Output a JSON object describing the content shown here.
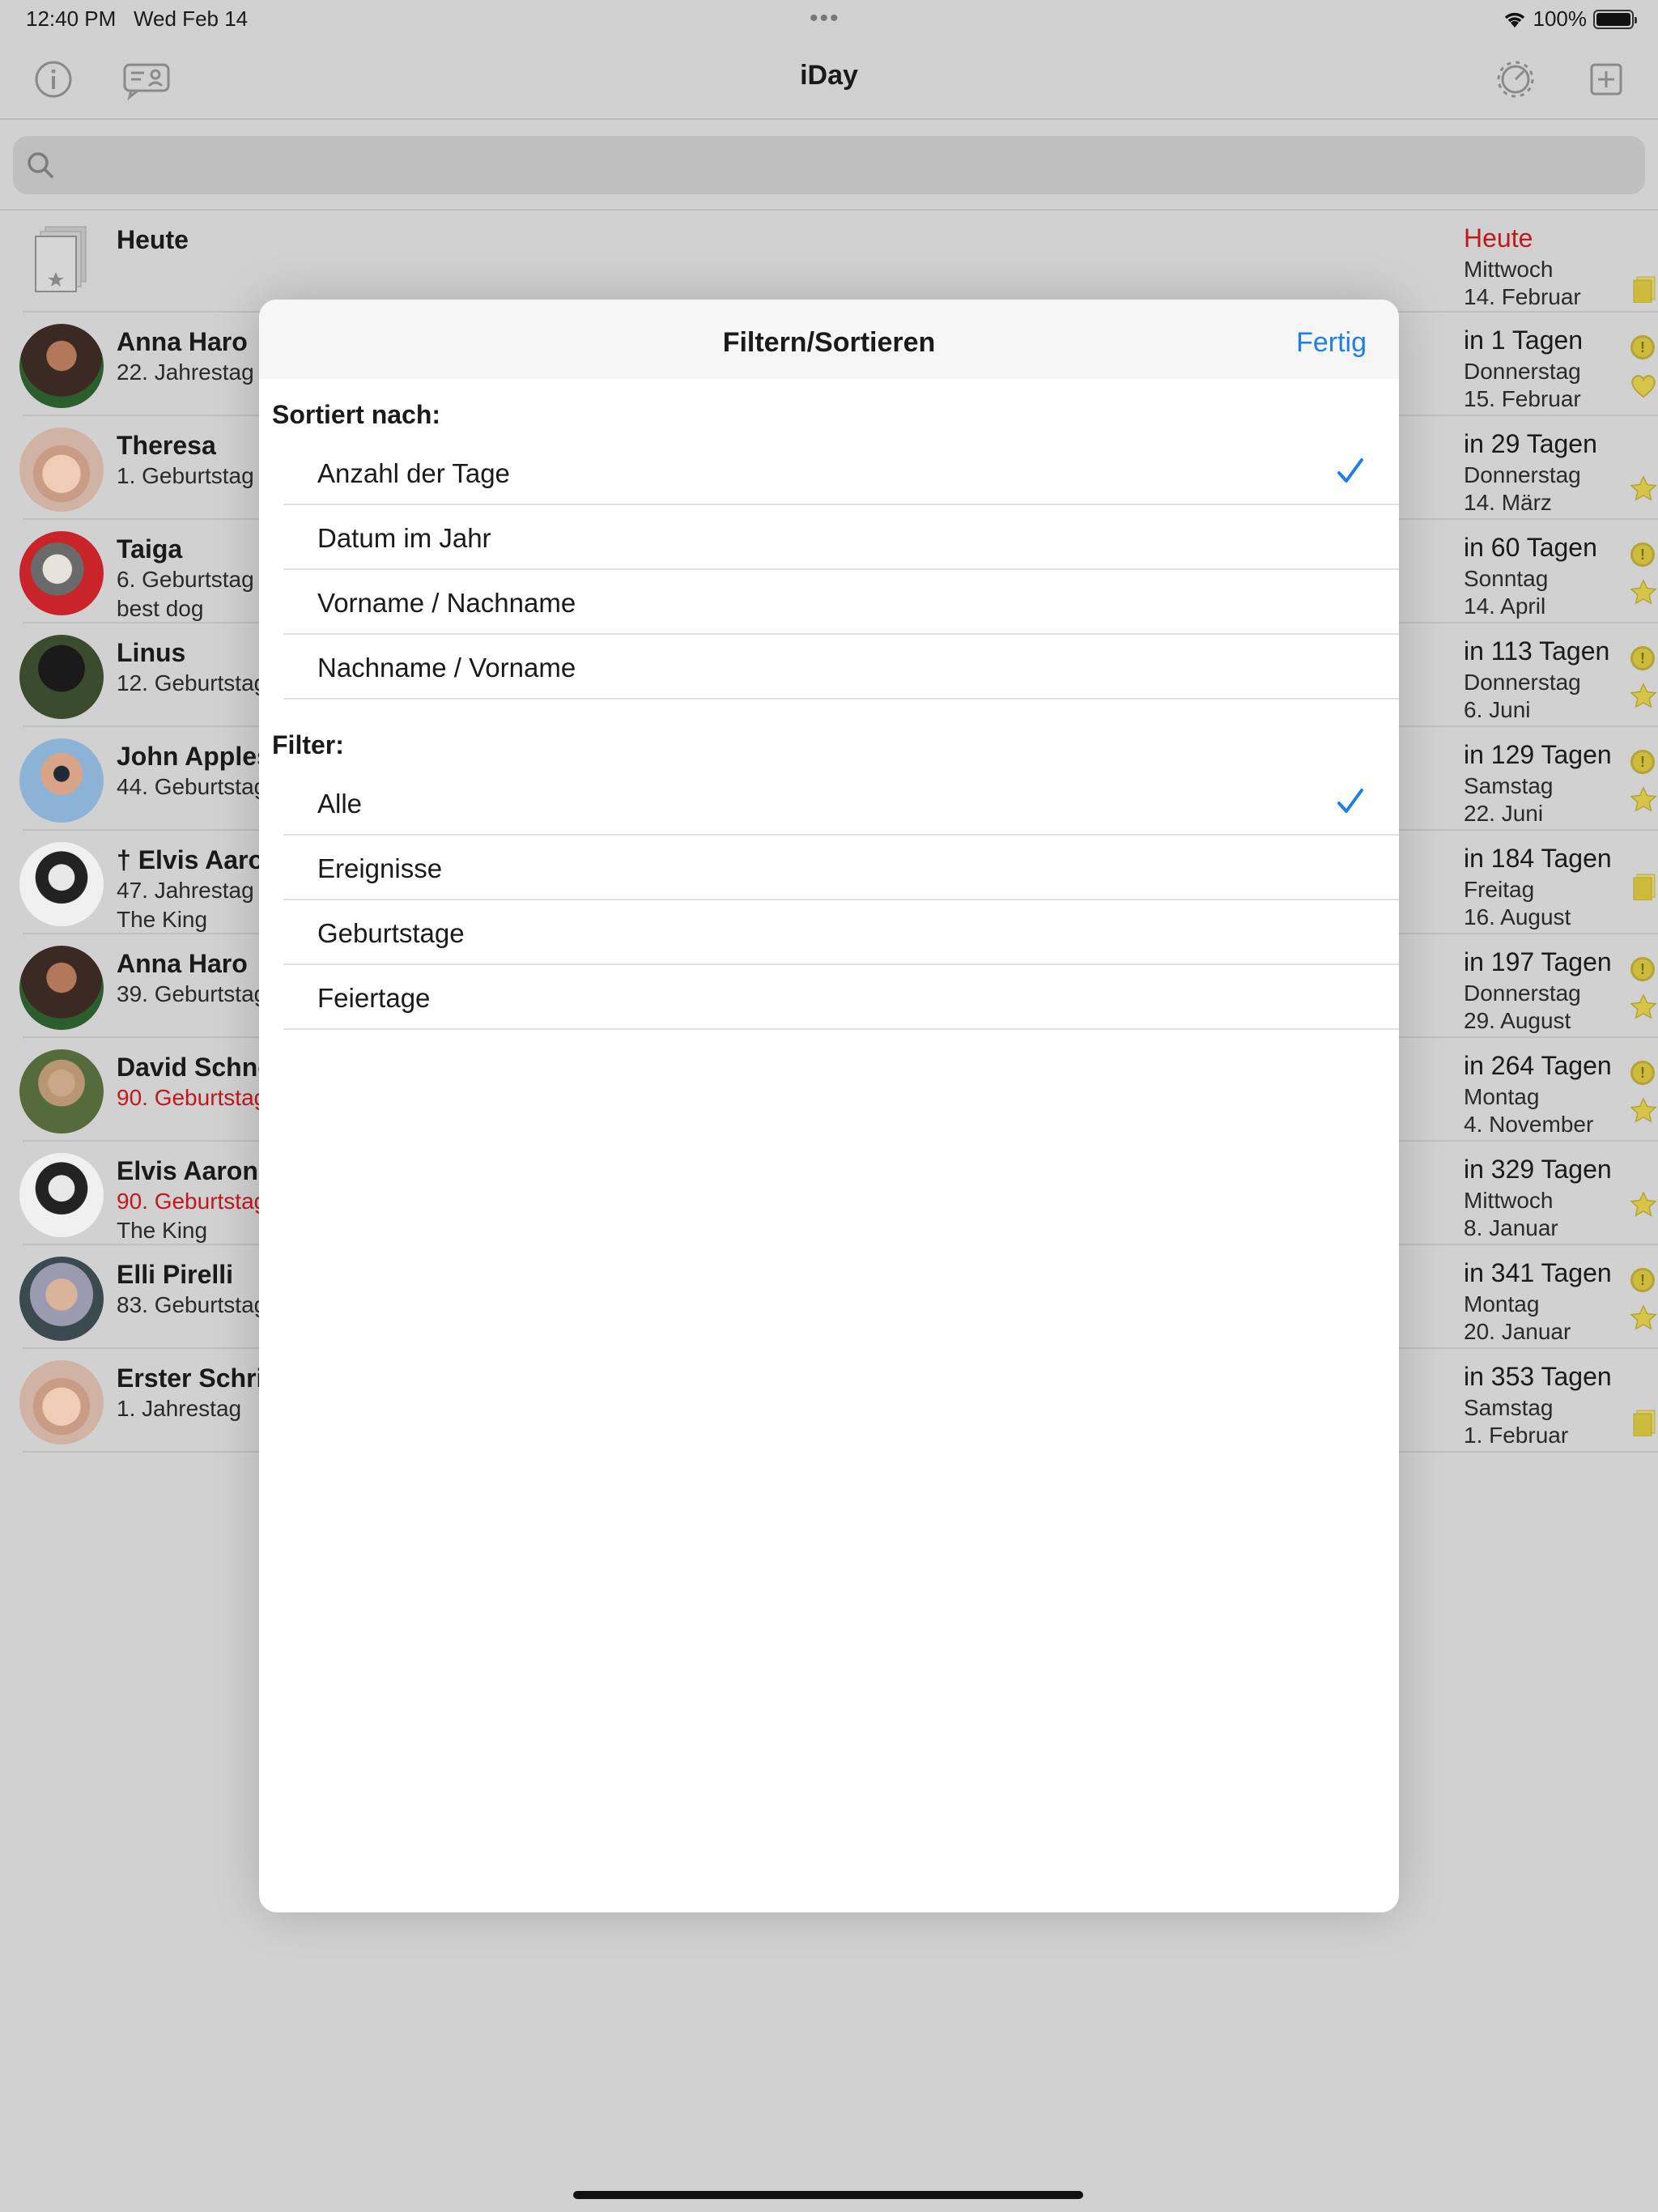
{
  "status": {
    "time": "12:40 PM",
    "date": "Wed Feb 14",
    "battery": "100%"
  },
  "nav": {
    "title": "iDay"
  },
  "search": {
    "placeholder": ""
  },
  "list": [
    {
      "name": "Heute",
      "sub": "",
      "note": "",
      "days": "Heute",
      "weekday": "Mittwoch",
      "date": "14. Februar"
    },
    {
      "name": "Anna Haro",
      "sub": "22.  Jahrestag",
      "note": "",
      "days": "in 1 Tagen",
      "weekday": "Donnerstag",
      "date": "15. Februar"
    },
    {
      "name": "Theresa",
      "sub": "1.  Geburtstag",
      "note": "",
      "days": "in 29 Tagen",
      "weekday": "Donnerstag",
      "date": "14. März"
    },
    {
      "name": "Taiga",
      "sub": "6.  Geburtstag",
      "note": "best dog",
      "days": "in 60 Tagen",
      "weekday": "Sonntag",
      "date": "14. April"
    },
    {
      "name": "Linus",
      "sub": "12.  Geburtstag",
      "note": "",
      "days": "in 113 Tagen",
      "weekday": "Donnerstag",
      "date": "6. Juni"
    },
    {
      "name": "John Appleseed",
      "sub": "44.  Geburtstag",
      "note": "",
      "days": "in 129 Tagen",
      "weekday": "Samstag",
      "date": "22. Juni"
    },
    {
      "name": "† Elvis Aaron Presley",
      "sub": "47.  Jahrestag",
      "note": "The King",
      "days": "in 184 Tagen",
      "weekday": "Freitag",
      "date": "16. August"
    },
    {
      "name": "Anna Haro",
      "sub": "39.  Geburtstag",
      "note": "",
      "days": "in 197 Tagen",
      "weekday": "Donnerstag",
      "date": "29. August"
    },
    {
      "name": "David Schneider",
      "sub": "90.  Geburtstag",
      "note": "",
      "days": "in 264 Tagen",
      "weekday": "Montag",
      "date": "4. November"
    },
    {
      "name": "Elvis Aaron Presley",
      "sub": "90.  Geburtstag",
      "note": "The King",
      "days": "in 329 Tagen",
      "weekday": "Mittwoch",
      "date": "8. Januar"
    },
    {
      "name": "Elli Pirelli",
      "sub": "83.  Geburtstag",
      "note": "",
      "days": "in 341 Tagen",
      "weekday": "Montag",
      "date": "20. Januar"
    },
    {
      "name": "Erster Schritt",
      "sub": "1.  Jahrestag",
      "note": "",
      "days": "in 353 Tagen",
      "weekday": "Samstag",
      "date": "1. Februar"
    }
  ],
  "modal": {
    "title": "Filtern/Sortieren",
    "done": "Fertig",
    "sort_heading": "Sortiert nach:",
    "sort_options": [
      "Anzahl der Tage",
      "Datum im Jahr",
      "Vorname / Nachname",
      "Nachname / Vorname"
    ],
    "sort_selected": "Anzahl der Tage",
    "filter_heading": "Filter:",
    "filter_options": [
      "Alle",
      "Ereignisse",
      "Geburtstage",
      "Feiertage"
    ],
    "filter_selected": "Alle"
  },
  "colors": {
    "accent": "#1e7fe6",
    "red": "#c0191c",
    "badge": "#cdbb3d"
  },
  "icons": {
    "info": "info-icon",
    "message": "message-icon",
    "settings": "gear-icon",
    "add": "add-icon",
    "search": "search-icon",
    "check": "checkmark-icon",
    "coin": "coin-icon",
    "star": "star-icon",
    "heart": "heart-icon",
    "card": "card-icon"
  }
}
